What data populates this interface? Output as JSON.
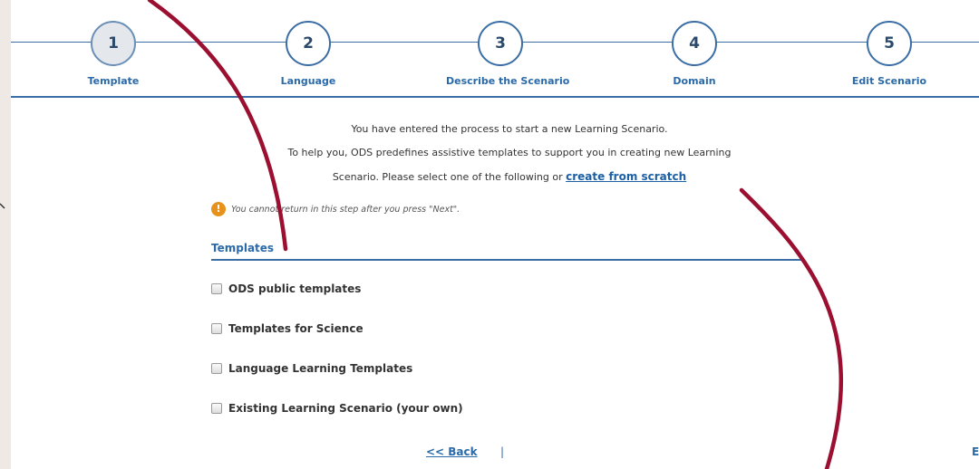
{
  "steps": [
    {
      "number": "1",
      "label": "Template",
      "active": true
    },
    {
      "number": "2",
      "label": "Language",
      "active": false
    },
    {
      "number": "3",
      "label": "Describe the Scenario",
      "active": false
    },
    {
      "number": "4",
      "label": "Domain",
      "active": false
    },
    {
      "number": "5",
      "label": "Edit Scenario",
      "active": false
    }
  ],
  "intro": {
    "line1": "You have entered the process to start a new Learning Scenario.",
    "line2": "To help you, ODS predefines assistive templates to support you in creating new Learning",
    "line3": "Scenario. Please select one of the following or",
    "link": "create from scratch"
  },
  "warning": {
    "text": "You cannot return in this step after you press \"Next\"."
  },
  "templates": {
    "title": "Templates",
    "options": [
      {
        "label": "ODS public templates"
      },
      {
        "label": "Templates for Science"
      },
      {
        "label": "Language Learning Templates"
      },
      {
        "label": "Existing Learning Scenario (your own)"
      }
    ]
  },
  "nav": {
    "back": "<< Back",
    "separator": "|",
    "next_partial": "E"
  },
  "colors": {
    "accent": "#3a6ea5",
    "link": "#1d5fa3",
    "annotation": "#9b1030",
    "warning": "#e8921e"
  }
}
